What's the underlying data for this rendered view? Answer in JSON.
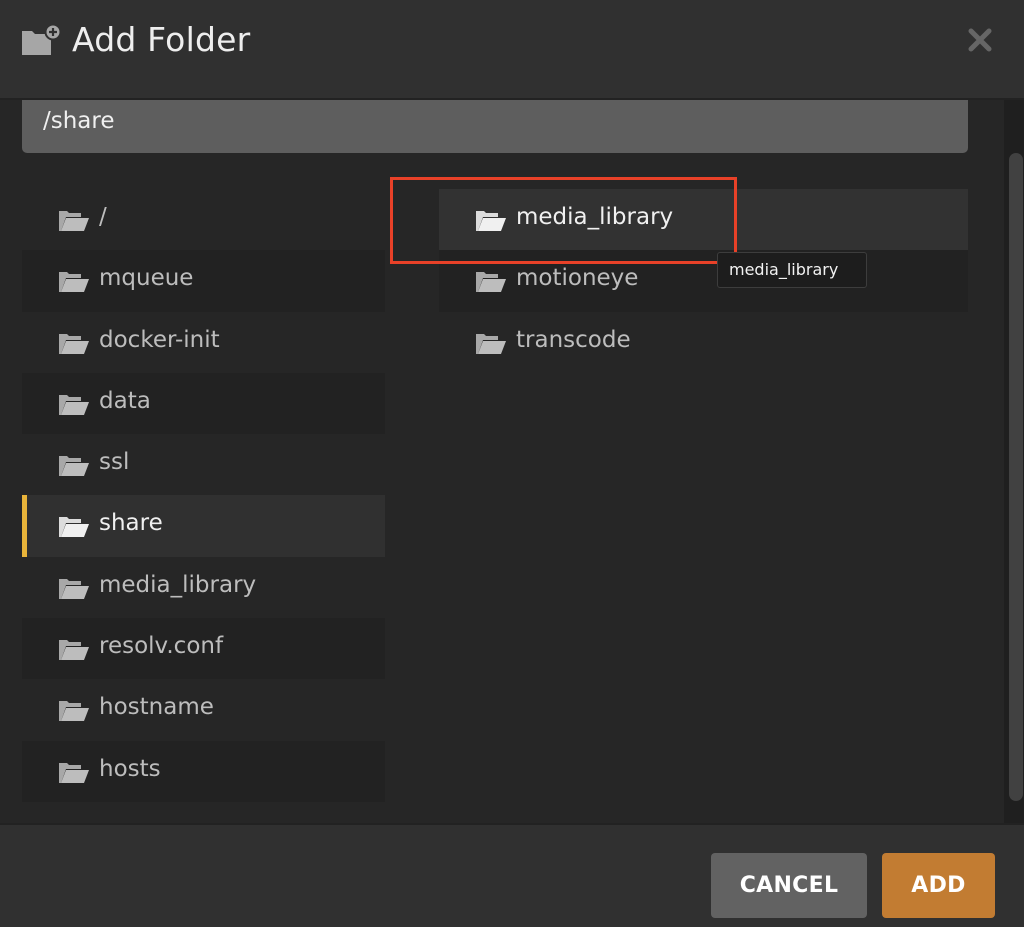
{
  "header": {
    "title": "Add Folder",
    "icon": "folder-plus-icon",
    "close_icon": "close-icon"
  },
  "path": {
    "value": "/share"
  },
  "left_column": {
    "items": [
      {
        "label": "/",
        "icon": "folder-open-icon",
        "state": "normal"
      },
      {
        "label": "mqueue",
        "icon": "folder-open-icon",
        "state": "normal"
      },
      {
        "label": "docker-init",
        "icon": "folder-open-icon",
        "state": "normal"
      },
      {
        "label": "data",
        "icon": "folder-open-icon",
        "state": "normal"
      },
      {
        "label": "ssl",
        "icon": "folder-open-icon",
        "state": "normal"
      },
      {
        "label": "share",
        "icon": "folder-open-icon",
        "state": "selected"
      },
      {
        "label": "media_library",
        "icon": "folder-open-icon",
        "state": "normal"
      },
      {
        "label": "resolv.conf",
        "icon": "folder-open-icon",
        "state": "normal"
      },
      {
        "label": "hostname",
        "icon": "folder-open-icon",
        "state": "normal"
      },
      {
        "label": "hosts",
        "icon": "folder-open-icon",
        "state": "normal"
      }
    ]
  },
  "right_column": {
    "items": [
      {
        "label": "media_library",
        "icon": "folder-open-icon",
        "state": "hover"
      },
      {
        "label": "motioneye",
        "icon": "folder-open-icon",
        "state": "normal"
      },
      {
        "label": "transcode",
        "icon": "folder-open-icon",
        "state": "normal"
      }
    ]
  },
  "tooltip": {
    "text": "media_library"
  },
  "footer": {
    "cancel_label": "CANCEL",
    "add_label": "ADD"
  },
  "colors": {
    "selected_accent": "#e9b43a",
    "add_button": "#c27c32",
    "cancel_button": "#626262",
    "annotation_box": "#e84128"
  }
}
